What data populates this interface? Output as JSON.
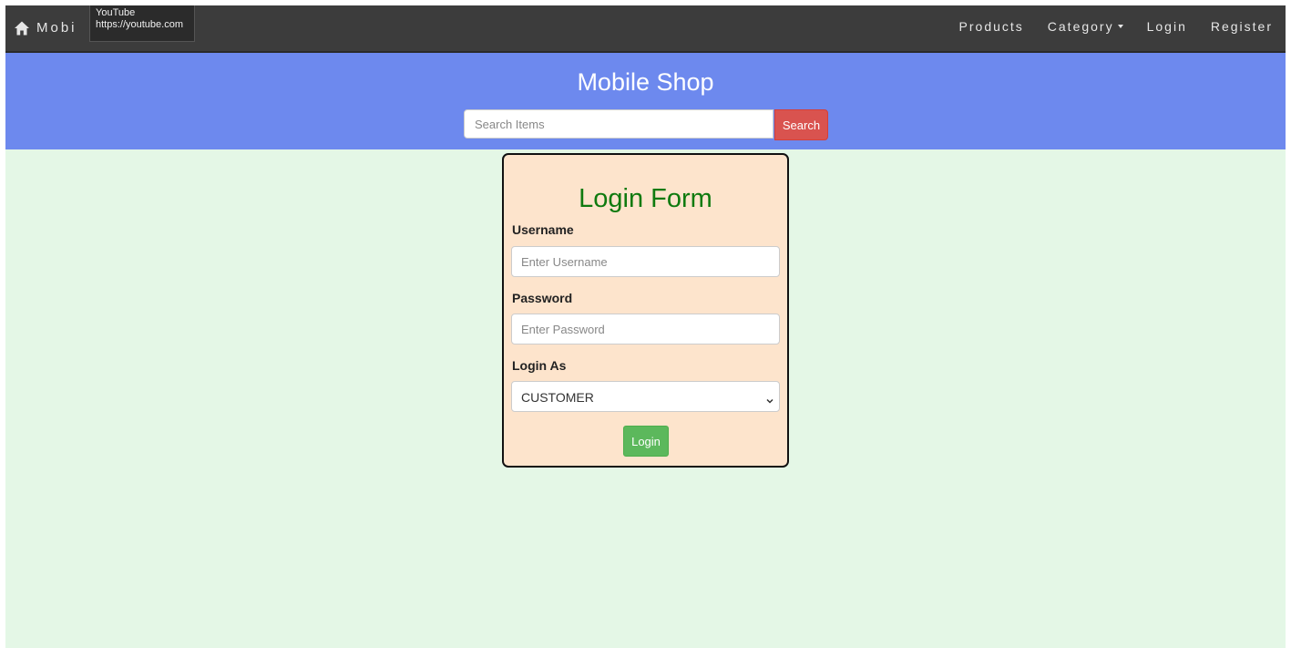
{
  "navbar": {
    "brand": "Mobi",
    "home_icon": "home-icon",
    "links": {
      "products": "Products",
      "category": "Category",
      "login": "Login",
      "register": "Register"
    }
  },
  "tooltip": {
    "title": "YouTube",
    "url": "https://youtube.com"
  },
  "header": {
    "title": "Mobile Shop",
    "search_placeholder": "Search Items",
    "search_button": "Search"
  },
  "login_form": {
    "title": "Login Form",
    "username_label": "Username",
    "username_placeholder": "Enter Username",
    "password_label": "Password",
    "password_placeholder": "Enter Password",
    "login_as_label": "Login As",
    "login_as_selected": "CUSTOMER",
    "submit_label": "Login"
  },
  "colors": {
    "navbar_bg": "#3c3c3c",
    "banner_bg": "#6d89ee",
    "page_bg": "#e4f7e6",
    "card_bg": "#fde4cc",
    "title_green": "#0f7a0f",
    "search_button_red": "#d9534f",
    "login_button_green": "#5cb85c"
  }
}
